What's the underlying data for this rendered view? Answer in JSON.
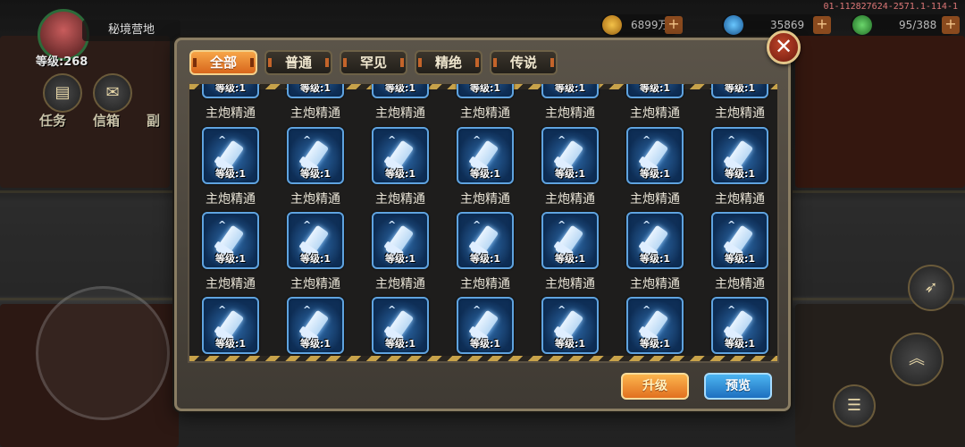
{
  "hud": {
    "location": "秘境营地",
    "level": "等级:268",
    "gold": "6899万",
    "gems": "35869",
    "energy": "95/388",
    "build_id": "01-112827624-2571.1-114-1",
    "menu_task": "任务",
    "menu_mail": "信箱",
    "menu_more": "副"
  },
  "tabs": [
    {
      "label": "全部",
      "active": true
    },
    {
      "label": "普通",
      "active": false
    },
    {
      "label": "罕见",
      "active": false
    },
    {
      "label": "精绝",
      "active": false
    },
    {
      "label": "传说",
      "active": false
    }
  ],
  "close_label": "✕",
  "partial_row": {
    "level": "等级:1",
    "names": [
      "主炮精通",
      "主炮精通",
      "主炮精通",
      "主炮精通",
      "主炮精通",
      "主炮精通",
      "主炮精通"
    ]
  },
  "rows": [
    {
      "items": [
        {
          "level": "等级:1",
          "name": "主炮精通"
        },
        {
          "level": "等级:1",
          "name": "主炮精通"
        },
        {
          "level": "等级:1",
          "name": "主炮精通"
        },
        {
          "level": "等级:1",
          "name": "主炮精通"
        },
        {
          "level": "等级:1",
          "name": "主炮精通"
        },
        {
          "level": "等级:1",
          "name": "主炮精通"
        },
        {
          "level": "等级:1",
          "name": "主炮精通"
        }
      ]
    },
    {
      "items": [
        {
          "level": "等级:1",
          "name": "主炮精通"
        },
        {
          "level": "等级:1",
          "name": "主炮精通"
        },
        {
          "level": "等级:1",
          "name": "主炮精通"
        },
        {
          "level": "等级:1",
          "name": "主炮精通"
        },
        {
          "level": "等级:1",
          "name": "主炮精通"
        },
        {
          "level": "等级:1",
          "name": "主炮精通"
        },
        {
          "level": "等级:1",
          "name": "主炮精通"
        }
      ]
    },
    {
      "items": [
        {
          "level": "等级:1",
          "name": ""
        },
        {
          "level": "等级:1",
          "name": ""
        },
        {
          "level": "等级:1",
          "name": ""
        },
        {
          "level": "等级:1",
          "name": ""
        },
        {
          "level": "等级:1",
          "name": ""
        },
        {
          "level": "等级:1",
          "name": ""
        },
        {
          "level": "等级:1",
          "name": ""
        }
      ]
    }
  ],
  "buttons": {
    "upgrade": "升级",
    "preview": "预览"
  },
  "colors": {
    "accent_orange": "#e2701f",
    "accent_blue": "#1d6fbf",
    "card_blue": "#2f6fb1"
  }
}
